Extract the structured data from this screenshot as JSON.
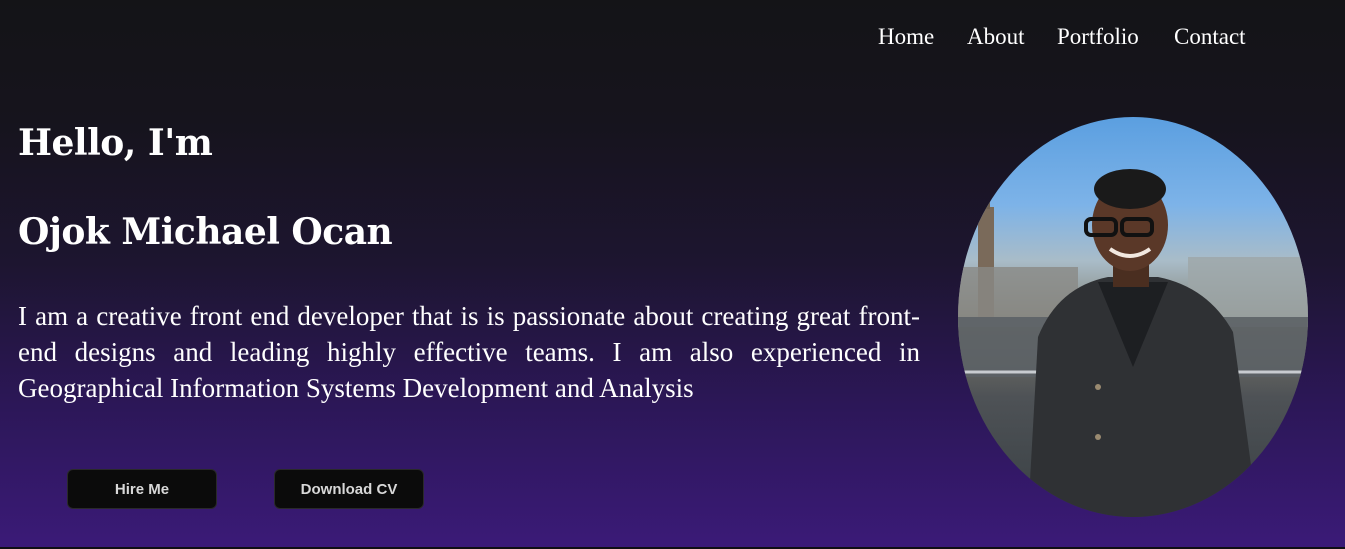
{
  "nav": {
    "items": [
      "Home",
      "About",
      "Portfolio",
      "Contact"
    ]
  },
  "hero": {
    "greeting": "Hello, I'm",
    "name": "Ojok Michael Ocan",
    "bio": "I am a creative front end developer that is is passionate about creating great front-end designs and leading highly effective teams. I am also experienced in Geographical Information Systems Development and Analysis",
    "buttons": {
      "hire": "Hire Me",
      "cv": "Download CV"
    }
  },
  "profile_photo": {
    "icon": "profile-photo"
  },
  "colors": {
    "background_top": "#141417",
    "background_bottom": "#3b1a78",
    "button_bg": "#0b0b0b",
    "text": "#ffffff"
  }
}
